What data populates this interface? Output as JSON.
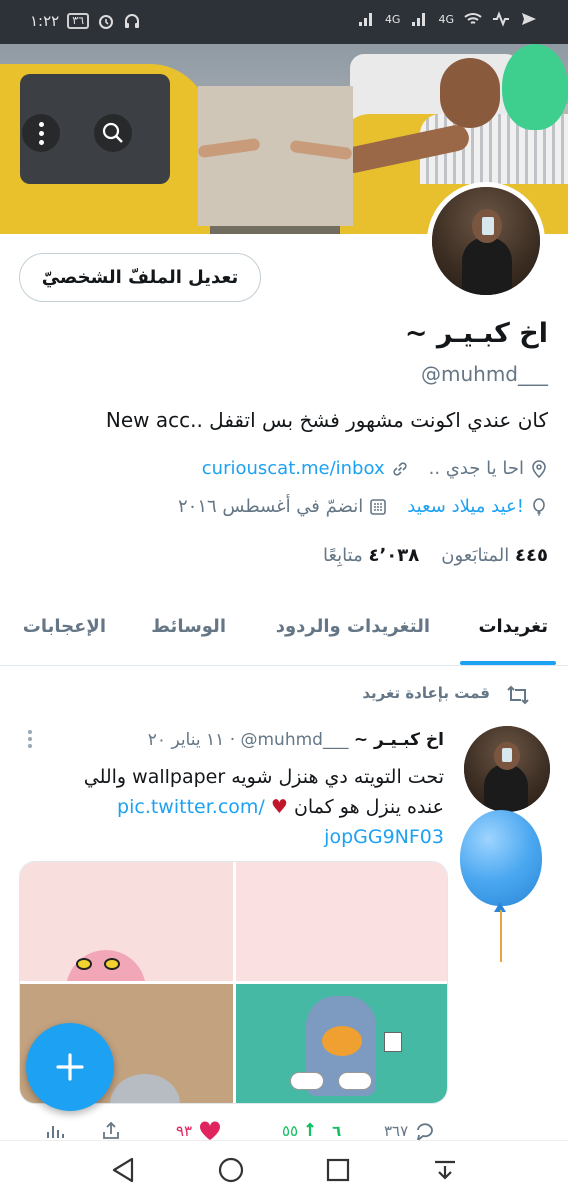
{
  "status_bar": {
    "time": "١:٢٢",
    "battery": "٣٦",
    "network_1": "4G",
    "network_2": "4G"
  },
  "header": {
    "menu_icon": "more-vertical-icon",
    "search_icon": "search-icon"
  },
  "profile": {
    "edit_button": "تعديل الملفّ الشخصيّ",
    "name": "اخ كبـيـر ~",
    "handle": "@muhmd___",
    "bio": "كان عندي اكونت مشهور فشخ بس اتقفل ..New acc",
    "location": "احا يا جدي ..",
    "website": "curiouscat.me/inbox",
    "birthday": "عيد ميلاد سعيد!",
    "joined": "انضمّ في أغسطس ٢٠١٦",
    "following_count": "٤٤٥",
    "following_label": "المتابَعون",
    "followers_count": "٤٬٠٣٨",
    "followers_label": "متابِعًا"
  },
  "tabs": [
    {
      "label": "تغريدات",
      "active": true
    },
    {
      "label": "التغريدات والردود",
      "active": false
    },
    {
      "label": "الوسائط",
      "active": false
    },
    {
      "label": "الإعجابات",
      "active": false
    }
  ],
  "tweet": {
    "retweet_note": "قمت بإعادة تغريد",
    "author_name": "اخ كبـيـر ~",
    "author_handle": "@muhmd___",
    "separator": "·",
    "date": "١١ يناير ٢٠",
    "text_line_1": "تحت التويته دي هنزل شويه wallpaper واللي",
    "text_line_2": "عنده ينزل هو كمان",
    "heart": "♥",
    "link_part_1": "pic.twitter.com/",
    "link_part_2": "jopGG9NF03",
    "reply_count": "٣٦٧",
    "retweet_count": "٥٥",
    "retweet_count_prefix": "٦",
    "like_count": "٩٣"
  },
  "colors": {
    "accent": "#1da1f2",
    "retweet": "#17bf63",
    "like": "#e0245e",
    "text_primary": "#14171a",
    "text_secondary": "#657786"
  }
}
